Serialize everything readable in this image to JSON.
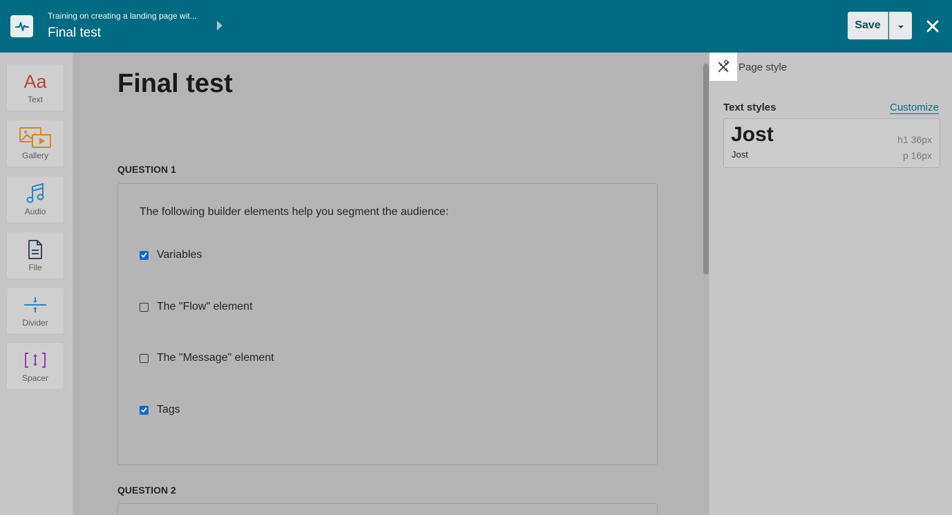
{
  "header": {
    "breadcrumb_parent": "Training on creating a landing page wit...",
    "title": "Final test",
    "save_label": "Save",
    "logo_icon": "pulse-icon",
    "close_icon": "close-icon",
    "colors": {
      "bar": "#006b82"
    }
  },
  "tools": [
    {
      "label": "Text",
      "icon": "text-aa-icon",
      "color": "#c0392b"
    },
    {
      "label": "Gallery",
      "icon": "gallery-icon",
      "color": "#e08a1e"
    },
    {
      "label": "Audio",
      "icon": "music-note-icon",
      "color": "#2e86c1"
    },
    {
      "label": "File",
      "icon": "file-icon",
      "color": "#34495e"
    },
    {
      "label": "Divider",
      "icon": "divider-icon",
      "color": "#2e86c1"
    },
    {
      "label": "Spacer",
      "icon": "spacer-icon",
      "color": "#8e44ad"
    }
  ],
  "tools_text_glyph": "Aa",
  "canvas": {
    "page_title": "Final test",
    "questions": [
      {
        "label": "QUESTION 1",
        "text": "The following builder elements help you segment the audience:",
        "options": [
          {
            "label": "Variables",
            "checked": true
          },
          {
            "label": "The \"Flow\" element",
            "checked": false
          },
          {
            "label": "The \"Message\" element",
            "checked": false
          },
          {
            "label": "Tags",
            "checked": true
          }
        ]
      },
      {
        "label": "QUESTION 2"
      }
    ]
  },
  "panel": {
    "tab_label": "Page style",
    "tab_icon": "design-tools-icon",
    "text_styles_title": "Text styles",
    "customize_label": "Customize",
    "heading_font": "Jost",
    "paragraph_font": "Jost",
    "heading_meta": "h1  36px",
    "paragraph_meta": "p  16px"
  }
}
